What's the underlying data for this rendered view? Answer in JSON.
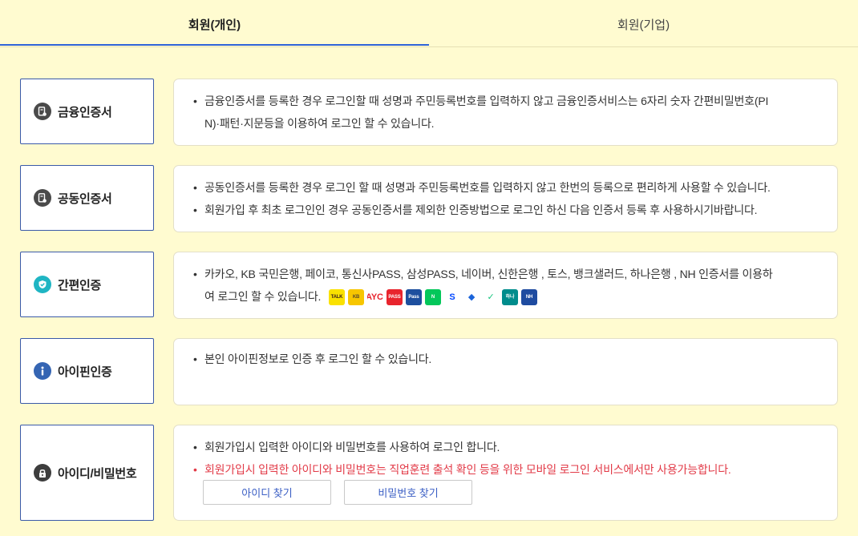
{
  "tabs": [
    {
      "label": "회원(개인)",
      "active": true
    },
    {
      "label": "회원(기업)",
      "active": false
    }
  ],
  "methods": [
    {
      "label": "금융인증서",
      "icon": "certificate-icon",
      "icon_color": "#4a4a4a"
    },
    {
      "label": "공동인증서",
      "icon": "certificate-icon",
      "icon_color": "#4a4a4a"
    },
    {
      "label": "간편인증",
      "icon": "check-shield-icon",
      "icon_color": "#1fb5c3"
    },
    {
      "label": "아이핀인증",
      "icon": "info-icon",
      "icon_color": "#3565b3"
    },
    {
      "label": "아이디/비밀번호",
      "icon": "lock-icon",
      "icon_color": "#3d3d3d"
    }
  ],
  "descriptions": {
    "finance_cert": [
      "금융인증서를 등록한 경우 로그인할 때 성명과 주민등록번호를 입력하지 않고 금융인증서비스는 6자리 숫자 간편비밀번호(PI",
      "N)·패턴·지문등을 이용하여 로그인 할 수 있습니다."
    ],
    "joint_cert": [
      "공동인증서를 등록한 경우 로그인 할 때 성명과 주민등록번호를 입력하지 않고 한번의 등록으로 편리하게 사용할 수 있습니다.",
      "회원가입 후 최초 로그인인 경우 공동인증서를 제외한 인증방법으로 로그인 하신 다음 인증서 등록 후 사용하시기바랍니다."
    ],
    "simple_auth": [
      "카카오, KB 국민은행, 페이코, 통신사PASS, 삼성PASS, 네이버, 신한은행 , 토스, 뱅크샐러드, 하나은행 , NH 인증서를 이용하",
      "여 로그인 할 수 있습니다."
    ],
    "ipin": [
      "본인 아이핀정보로 인증 후 로그인 할 수 있습니다."
    ],
    "id_password": {
      "line1": "회원가입시 입력한 아이디와 비밀번호를 사용하여 로그인 합니다.",
      "line2": "회원가입시 입력한 아이디와 비밀번호는 직업훈련 출석 확인 등을 위한 모바일 로그인 서비스에서만 사용가능합니다.",
      "find_id_button": "아이디 찾기",
      "find_password_button": "비밀번호 찾기"
    }
  },
  "providers": [
    {
      "name": "kakao-icon",
      "bg": "#fae100",
      "fg": "#3a1d1d",
      "text": "TALK"
    },
    {
      "name": "kb-icon",
      "bg": "#f7c600",
      "fg": "#5a4a2a",
      "text": "KB"
    },
    {
      "name": "payco-icon",
      "bg": "#ffffff",
      "fg": "#e8242d",
      "text": "PAYCO"
    },
    {
      "name": "pass-icon",
      "bg": "#e8242d",
      "fg": "#ffffff",
      "text": "PASS"
    },
    {
      "name": "samsung-pass-icon",
      "bg": "#1d4f9e",
      "fg": "#ffffff",
      "text": "Pass"
    },
    {
      "name": "naver-icon",
      "bg": "#03c75a",
      "fg": "#ffffff",
      "text": "N"
    },
    {
      "name": "shinhan-icon",
      "bg": "#ffffff",
      "fg": "#0046ff",
      "text": "S"
    },
    {
      "name": "toss-icon",
      "bg": "#ffffff",
      "fg": "#1b64da",
      "text": "◆"
    },
    {
      "name": "banksalad-icon",
      "bg": "#ffffff",
      "fg": "#15c47e",
      "text": "✓"
    },
    {
      "name": "hana-icon",
      "bg": "#008c8c",
      "fg": "#ffffff",
      "text": "하나"
    },
    {
      "name": "nh-icon",
      "bg": "#1e4ba0",
      "fg": "#ffffff",
      "text": "NH"
    }
  ],
  "colors": {
    "page_bg": "#fffbd0",
    "tab_underline": "#2f64d8",
    "method_border": "#3a5aa8",
    "warning_text": "#e23a47",
    "link_text": "#3a5ec4"
  }
}
